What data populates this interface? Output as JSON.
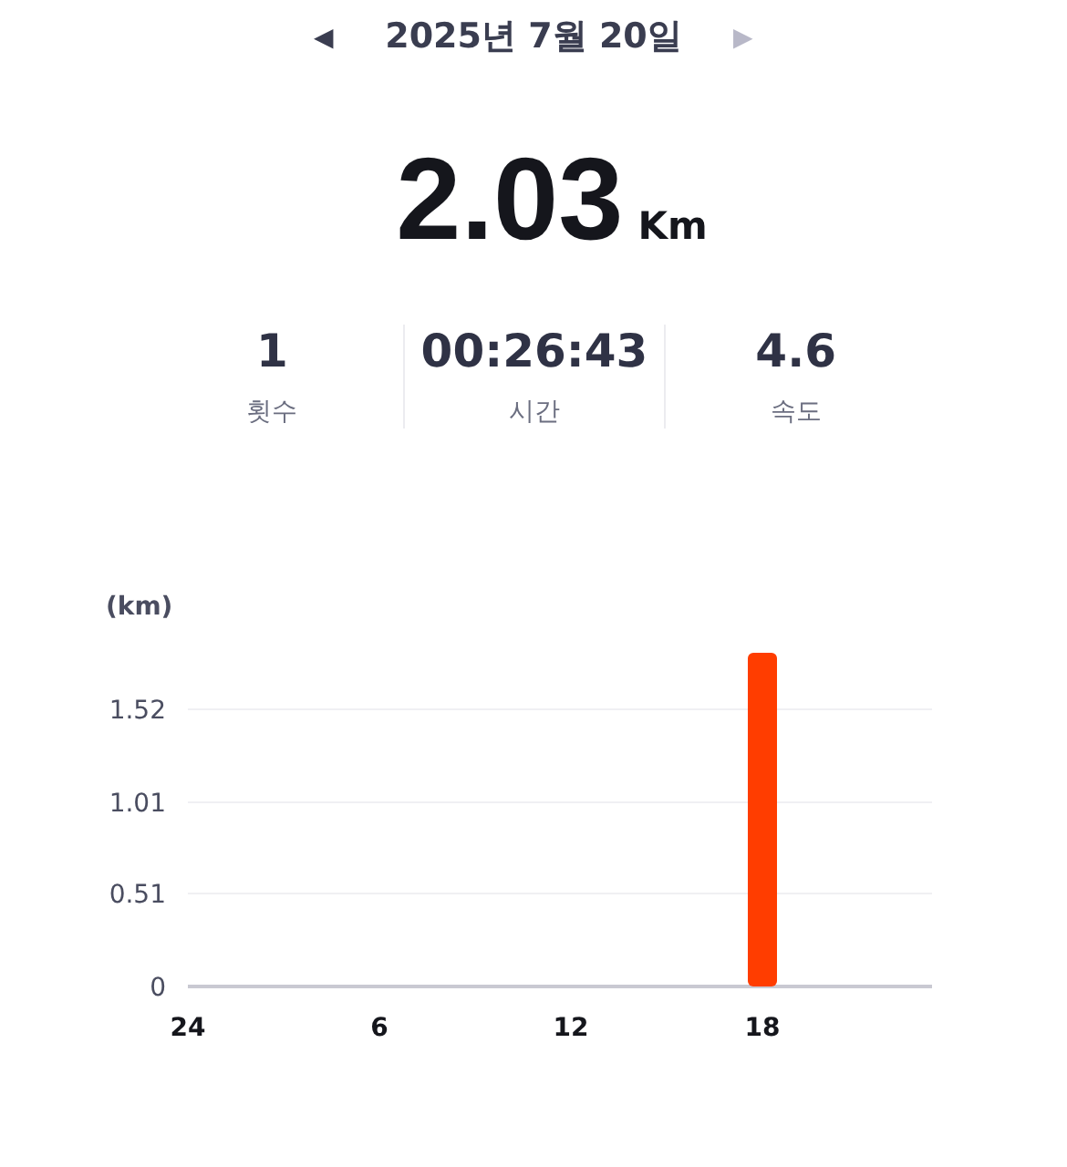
{
  "header": {
    "prev": "◀",
    "date": "2025년 7월 20일",
    "next": "▶",
    "next_disabled": true
  },
  "distance": {
    "value": "2.03",
    "unit": "Km"
  },
  "stats": [
    {
      "value": "1",
      "label": "횟수"
    },
    {
      "value": "00:26:43",
      "label": "시간"
    },
    {
      "value": "4.6",
      "label": "속도"
    }
  ],
  "chart": {
    "chart_data": {
      "type": "bar",
      "ylabel": "(km)",
      "categories": [
        "24",
        "6",
        "12",
        "18"
      ],
      "values": [
        null,
        null,
        null,
        1.83
      ],
      "ylim": [
        0,
        1.83
      ],
      "yticks": [
        0,
        0.51,
        1.01,
        1.52
      ],
      "grid": true
    }
  }
}
